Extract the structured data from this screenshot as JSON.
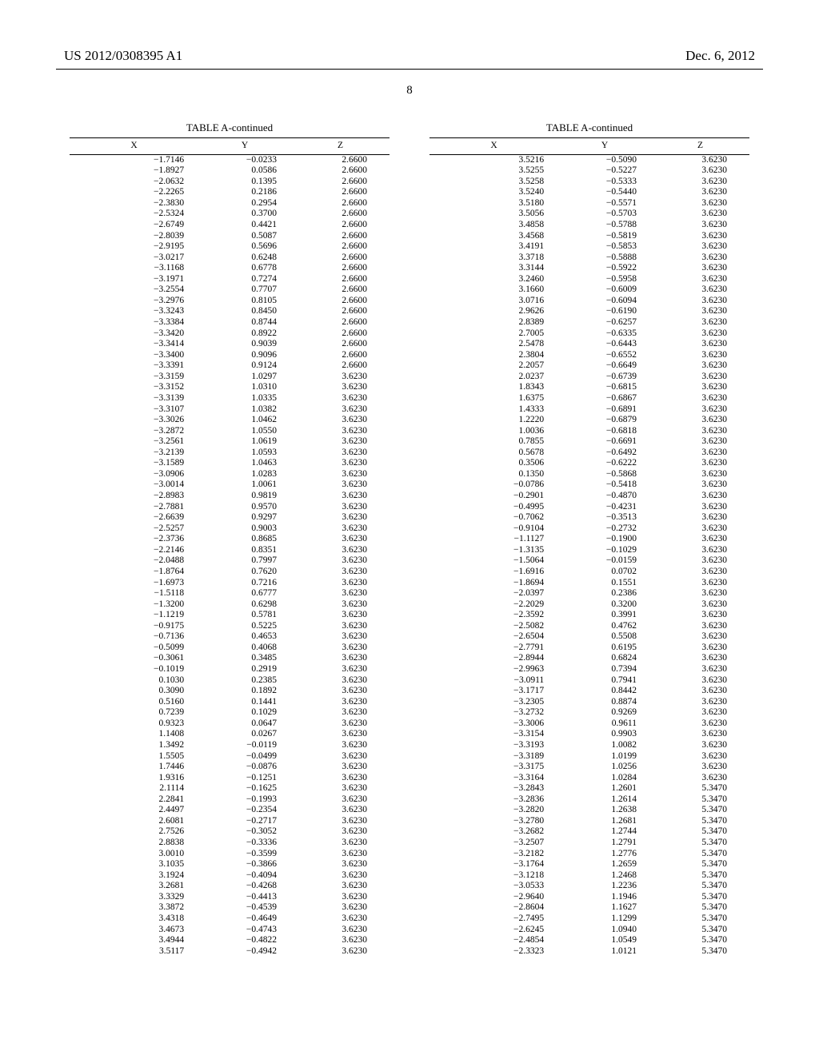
{
  "header": {
    "left": "US 2012/0308395 A1",
    "right": "Dec. 6, 2012",
    "page_number": "8"
  },
  "tables": {
    "title": "TABLE A-continued",
    "headers": [
      "X",
      "Y",
      "Z"
    ],
    "left_rows": [
      [
        "-1.7146",
        "-0.0233",
        "2.6600"
      ],
      [
        "-1.8927",
        "0.0586",
        "2.6600"
      ],
      [
        "-2.0632",
        "0.1395",
        "2.6600"
      ],
      [
        "-2.2265",
        "0.2186",
        "2.6600"
      ],
      [
        "-2.3830",
        "0.2954",
        "2.6600"
      ],
      [
        "-2.5324",
        "0.3700",
        "2.6600"
      ],
      [
        "-2.6749",
        "0.4421",
        "2.6600"
      ],
      [
        "-2.8039",
        "0.5087",
        "2.6600"
      ],
      [
        "-2.9195",
        "0.5696",
        "2.6600"
      ],
      [
        "-3.0217",
        "0.6248",
        "2.6600"
      ],
      [
        "-3.1168",
        "0.6778",
        "2.6600"
      ],
      [
        "-3.1971",
        "0.7274",
        "2.6600"
      ],
      [
        "-3.2554",
        "0.7707",
        "2.6600"
      ],
      [
        "-3.2976",
        "0.8105",
        "2.6600"
      ],
      [
        "-3.3243",
        "0.8450",
        "2.6600"
      ],
      [
        "-3.3384",
        "0.8744",
        "2.6600"
      ],
      [
        "-3.3420",
        "0.8922",
        "2.6600"
      ],
      [
        "-3.3414",
        "0.9039",
        "2.6600"
      ],
      [
        "-3.3400",
        "0.9096",
        "2.6600"
      ],
      [
        "-3.3391",
        "0.9124",
        "2.6600"
      ],
      [
        "-3.3159",
        "1.0297",
        "3.6230"
      ],
      [
        "-3.3152",
        "1.0310",
        "3.6230"
      ],
      [
        "-3.3139",
        "1.0335",
        "3.6230"
      ],
      [
        "-3.3107",
        "1.0382",
        "3.6230"
      ],
      [
        "-3.3026",
        "1.0462",
        "3.6230"
      ],
      [
        "-3.2872",
        "1.0550",
        "3.6230"
      ],
      [
        "-3.2561",
        "1.0619",
        "3.6230"
      ],
      [
        "-3.2139",
        "1.0593",
        "3.6230"
      ],
      [
        "-3.1589",
        "1.0463",
        "3.6230"
      ],
      [
        "-3.0906",
        "1.0283",
        "3.6230"
      ],
      [
        "-3.0014",
        "1.0061",
        "3.6230"
      ],
      [
        "-2.8983",
        "0.9819",
        "3.6230"
      ],
      [
        "-2.7881",
        "0.9570",
        "3.6230"
      ],
      [
        "-2.6639",
        "0.9297",
        "3.6230"
      ],
      [
        "-2.5257",
        "0.9003",
        "3.6230"
      ],
      [
        "-2.3736",
        "0.8685",
        "3.6230"
      ],
      [
        "-2.2146",
        "0.8351",
        "3.6230"
      ],
      [
        "-2.0488",
        "0.7997",
        "3.6230"
      ],
      [
        "-1.8764",
        "0.7620",
        "3.6230"
      ],
      [
        "-1.6973",
        "0.7216",
        "3.6230"
      ],
      [
        "-1.5118",
        "0.6777",
        "3.6230"
      ],
      [
        "-1.3200",
        "0.6298",
        "3.6230"
      ],
      [
        "-1.1219",
        "0.5781",
        "3.6230"
      ],
      [
        "-0.9175",
        "0.5225",
        "3.6230"
      ],
      [
        "-0.7136",
        "0.4653",
        "3.6230"
      ],
      [
        "-0.5099",
        "0.4068",
        "3.6230"
      ],
      [
        "-0.3061",
        "0.3485",
        "3.6230"
      ],
      [
        "-0.1019",
        "0.2919",
        "3.6230"
      ],
      [
        "0.1030",
        "0.2385",
        "3.6230"
      ],
      [
        "0.3090",
        "0.1892",
        "3.6230"
      ],
      [
        "0.5160",
        "0.1441",
        "3.6230"
      ],
      [
        "0.7239",
        "0.1029",
        "3.6230"
      ],
      [
        "0.9323",
        "0.0647",
        "3.6230"
      ],
      [
        "1.1408",
        "0.0267",
        "3.6230"
      ],
      [
        "1.3492",
        "-0.0119",
        "3.6230"
      ],
      [
        "1.5505",
        "-0.0499",
        "3.6230"
      ],
      [
        "1.7446",
        "-0.0876",
        "3.6230"
      ],
      [
        "1.9316",
        "-0.1251",
        "3.6230"
      ],
      [
        "2.1114",
        "-0.1625",
        "3.6230"
      ],
      [
        "2.2841",
        "-0.1993",
        "3.6230"
      ],
      [
        "2.4497",
        "-0.2354",
        "3.6230"
      ],
      [
        "2.6081",
        "-0.2717",
        "3.6230"
      ],
      [
        "2.7526",
        "-0.3052",
        "3.6230"
      ],
      [
        "2.8838",
        "-0.3336",
        "3.6230"
      ],
      [
        "3.0010",
        "-0.3599",
        "3.6230"
      ],
      [
        "3.1035",
        "-0.3866",
        "3.6230"
      ],
      [
        "3.1924",
        "-0.4094",
        "3.6230"
      ],
      [
        "3.2681",
        "-0.4268",
        "3.6230"
      ],
      [
        "3.3329",
        "-0.4413",
        "3.6230"
      ],
      [
        "3.3872",
        "-0.4539",
        "3.6230"
      ],
      [
        "3.4318",
        "-0.4649",
        "3.6230"
      ],
      [
        "3.4673",
        "-0.4743",
        "3.6230"
      ],
      [
        "3.4944",
        "-0.4822",
        "3.6230"
      ],
      [
        "3.5117",
        "-0.4942",
        "3.6230"
      ]
    ],
    "right_rows": [
      [
        "3.5216",
        "-0.5090",
        "3.6230"
      ],
      [
        "3.5255",
        "-0.5227",
        "3.6230"
      ],
      [
        "3.5258",
        "-0.5333",
        "3.6230"
      ],
      [
        "3.5240",
        "-0.5440",
        "3.6230"
      ],
      [
        "3.5180",
        "-0.5571",
        "3.6230"
      ],
      [
        "3.5056",
        "-0.5703",
        "3.6230"
      ],
      [
        "3.4858",
        "-0.5788",
        "3.6230"
      ],
      [
        "3.4568",
        "-0.5819",
        "3.6230"
      ],
      [
        "3.4191",
        "-0.5853",
        "3.6230"
      ],
      [
        "3.3718",
        "-0.5888",
        "3.6230"
      ],
      [
        "3.3144",
        "-0.5922",
        "3.6230"
      ],
      [
        "3.2460",
        "-0.5958",
        "3.6230"
      ],
      [
        "3.1660",
        "-0.6009",
        "3.6230"
      ],
      [
        "3.0716",
        "-0.6094",
        "3.6230"
      ],
      [
        "2.9626",
        "-0.6190",
        "3.6230"
      ],
      [
        "2.8389",
        "-0.6257",
        "3.6230"
      ],
      [
        "2.7005",
        "-0.6335",
        "3.6230"
      ],
      [
        "2.5478",
        "-0.6443",
        "3.6230"
      ],
      [
        "2.3804",
        "-0.6552",
        "3.6230"
      ],
      [
        "2.2057",
        "-0.6649",
        "3.6230"
      ],
      [
        "2.0237",
        "-0.6739",
        "3.6230"
      ],
      [
        "1.8343",
        "-0.6815",
        "3.6230"
      ],
      [
        "1.6375",
        "-0.6867",
        "3.6230"
      ],
      [
        "1.4333",
        "-0.6891",
        "3.6230"
      ],
      [
        "1.2220",
        "-0.6879",
        "3.6230"
      ],
      [
        "1.0036",
        "-0.6818",
        "3.6230"
      ],
      [
        "0.7855",
        "-0.6691",
        "3.6230"
      ],
      [
        "0.5678",
        "-0.6492",
        "3.6230"
      ],
      [
        "0.3506",
        "-0.6222",
        "3.6230"
      ],
      [
        "0.1350",
        "-0.5868",
        "3.6230"
      ],
      [
        "-0.0786",
        "-0.5418",
        "3.6230"
      ],
      [
        "-0.2901",
        "-0.4870",
        "3.6230"
      ],
      [
        "-0.4995",
        "-0.4231",
        "3.6230"
      ],
      [
        "-0.7062",
        "-0.3513",
        "3.6230"
      ],
      [
        "-0.9104",
        "-0.2732",
        "3.6230"
      ],
      [
        "-1.1127",
        "-0.1900",
        "3.6230"
      ],
      [
        "-1.3135",
        "-0.1029",
        "3.6230"
      ],
      [
        "-1.5064",
        "-0.0159",
        "3.6230"
      ],
      [
        "-1.6916",
        "0.0702",
        "3.6230"
      ],
      [
        "-1.8694",
        "0.1551",
        "3.6230"
      ],
      [
        "-2.0397",
        "0.2386",
        "3.6230"
      ],
      [
        "-2.2029",
        "0.3200",
        "3.6230"
      ],
      [
        "-2.3592",
        "0.3991",
        "3.6230"
      ],
      [
        "-2.5082",
        "0.4762",
        "3.6230"
      ],
      [
        "-2.6504",
        "0.5508",
        "3.6230"
      ],
      [
        "-2.7791",
        "0.6195",
        "3.6230"
      ],
      [
        "-2.8944",
        "0.6824",
        "3.6230"
      ],
      [
        "-2.9963",
        "0.7394",
        "3.6230"
      ],
      [
        "-3.0911",
        "0.7941",
        "3.6230"
      ],
      [
        "-3.1717",
        "0.8442",
        "3.6230"
      ],
      [
        "-3.2305",
        "0.8874",
        "3.6230"
      ],
      [
        "-3.2732",
        "0.9269",
        "3.6230"
      ],
      [
        "-3.3006",
        "0.9611",
        "3.6230"
      ],
      [
        "-3.3154",
        "0.9903",
        "3.6230"
      ],
      [
        "-3.3193",
        "1.0082",
        "3.6230"
      ],
      [
        "-3.3189",
        "1.0199",
        "3.6230"
      ],
      [
        "-3.3175",
        "1.0256",
        "3.6230"
      ],
      [
        "-3.3164",
        "1.0284",
        "3.6230"
      ],
      [
        "-3.2843",
        "1.2601",
        "5.3470"
      ],
      [
        "-3.2836",
        "1.2614",
        "5.3470"
      ],
      [
        "-3.2820",
        "1.2638",
        "5.3470"
      ],
      [
        "-3.2780",
        "1.2681",
        "5.3470"
      ],
      [
        "-3.2682",
        "1.2744",
        "5.3470"
      ],
      [
        "-3.2507",
        "1.2791",
        "5.3470"
      ],
      [
        "-3.2182",
        "1.2776",
        "5.3470"
      ],
      [
        "-3.1764",
        "1.2659",
        "5.3470"
      ],
      [
        "-3.1218",
        "1.2468",
        "5.3470"
      ],
      [
        "-3.0533",
        "1.2236",
        "5.3470"
      ],
      [
        "-2.9640",
        "1.1946",
        "5.3470"
      ],
      [
        "-2.8604",
        "1.1627",
        "5.3470"
      ],
      [
        "-2.7495",
        "1.1299",
        "5.3470"
      ],
      [
        "-2.6245",
        "1.0940",
        "5.3470"
      ],
      [
        "-2.4854",
        "1.0549",
        "5.3470"
      ],
      [
        "-2.3323",
        "1.0121",
        "5.3470"
      ]
    ]
  }
}
